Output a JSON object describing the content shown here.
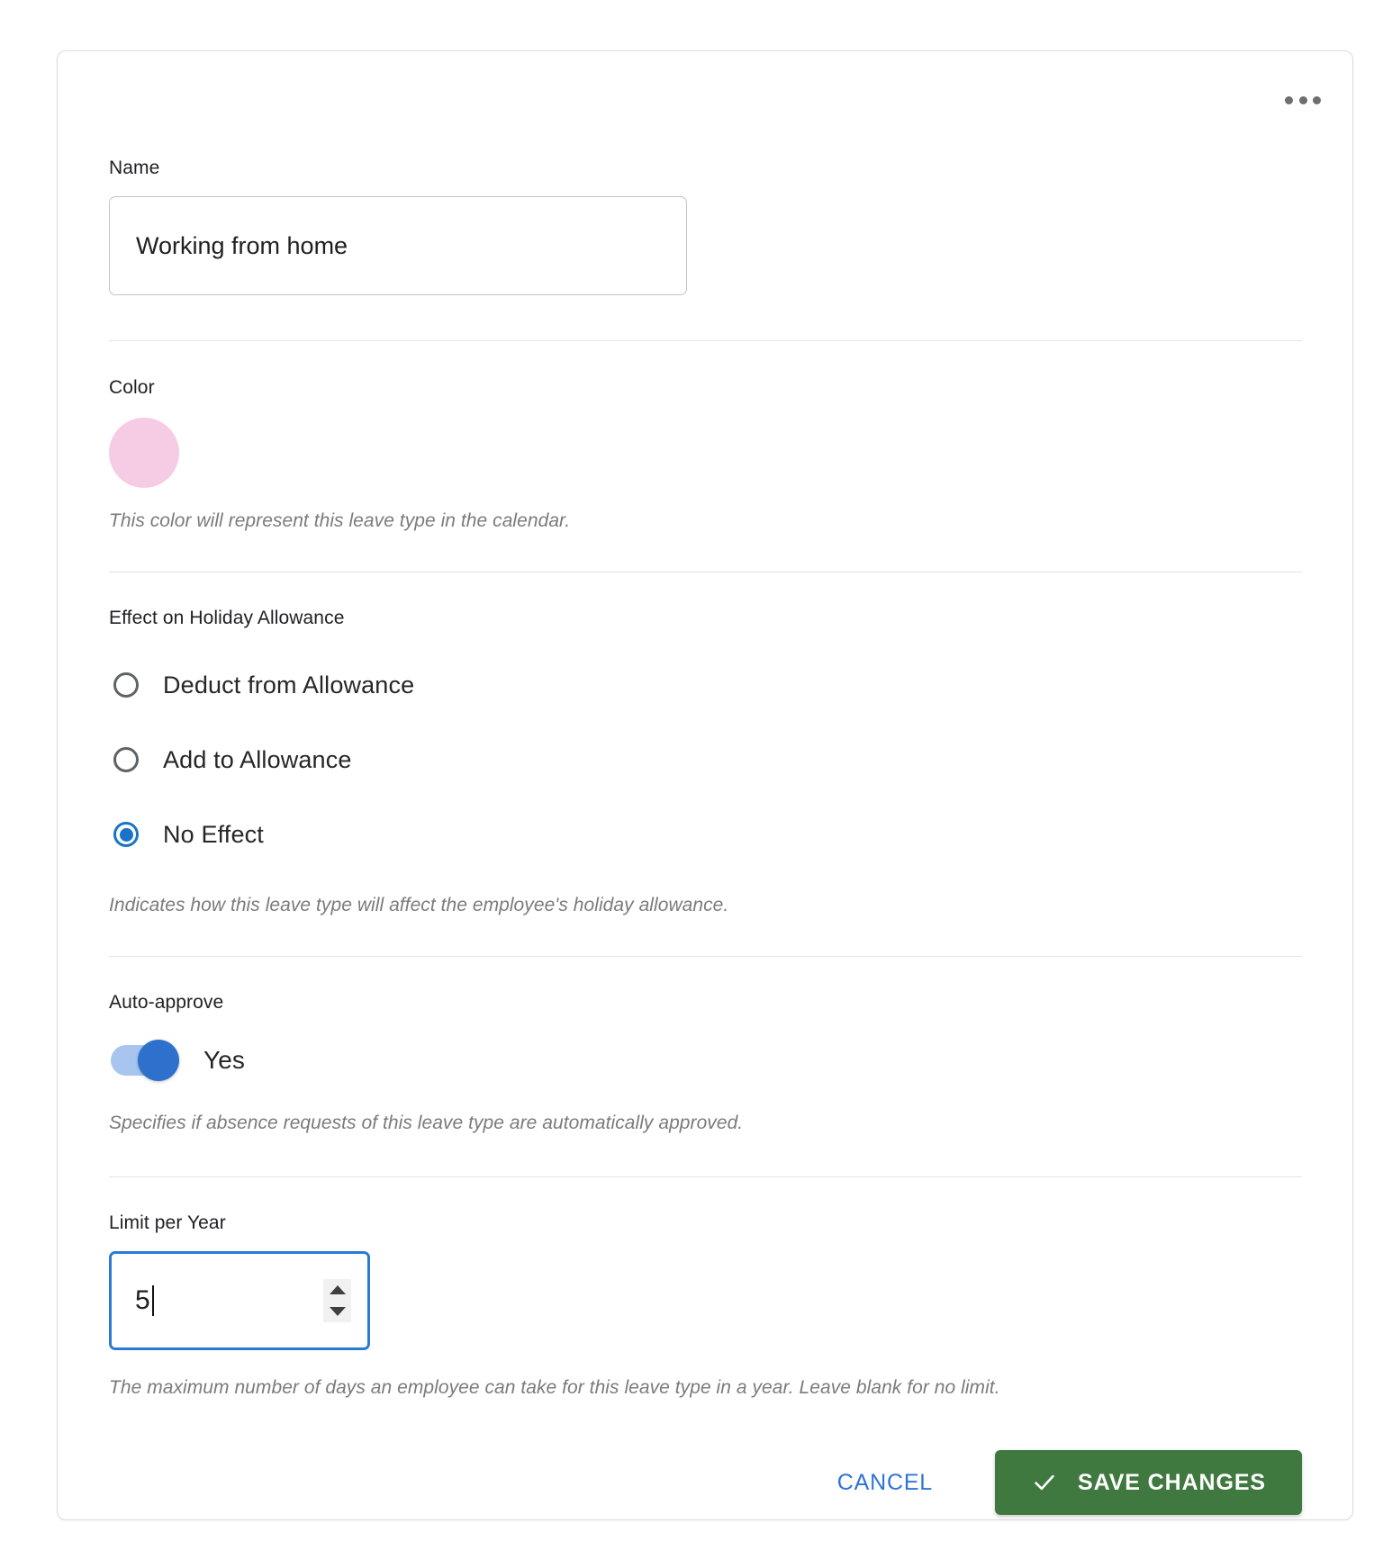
{
  "card": {
    "more_menu": {
      "icon": "more-horizontal-icon",
      "dots": 3
    }
  },
  "name_field": {
    "label": "Name",
    "value": "Working from home",
    "placeholder": "Name"
  },
  "color_field": {
    "label": "Color",
    "swatch_color": "#F6CBE4",
    "helper": "This color will represent this leave type in the calendar."
  },
  "effect_field": {
    "label": "Effect on Holiday Allowance",
    "options": [
      {
        "label": "Deduct from Allowance",
        "selected": false
      },
      {
        "label": "Add to Allowance",
        "selected": false
      },
      {
        "label": "No Effect",
        "selected": true
      }
    ],
    "helper": "Indicates how this leave type will affect the employee's holiday allowance.",
    "accent": "#1A73C8"
  },
  "auto_approve_field": {
    "label": "Auto-approve",
    "toggle_state": "on",
    "toggle_label": "Yes",
    "helper": "Specifies if absence requests of this leave type are automatically approved.",
    "track_color": "#A7C5EE",
    "thumb_color": "#2E71CC"
  },
  "limit_field": {
    "label": "Limit per Year",
    "value": "5",
    "focused": true,
    "focus_color": "#2B7BD4",
    "spinner": {
      "up_icon": "caret-up-icon",
      "down_icon": "caret-down-icon"
    },
    "helper": "The maximum number of days an employee can take for this leave type in a year. Leave blank for no limit."
  },
  "actions": {
    "cancel_label": "CANCEL",
    "cancel_color": "#2D74D6",
    "save_label": "SAVE CHANGES",
    "save_icon": "check-icon",
    "save_color": "#40793F"
  }
}
